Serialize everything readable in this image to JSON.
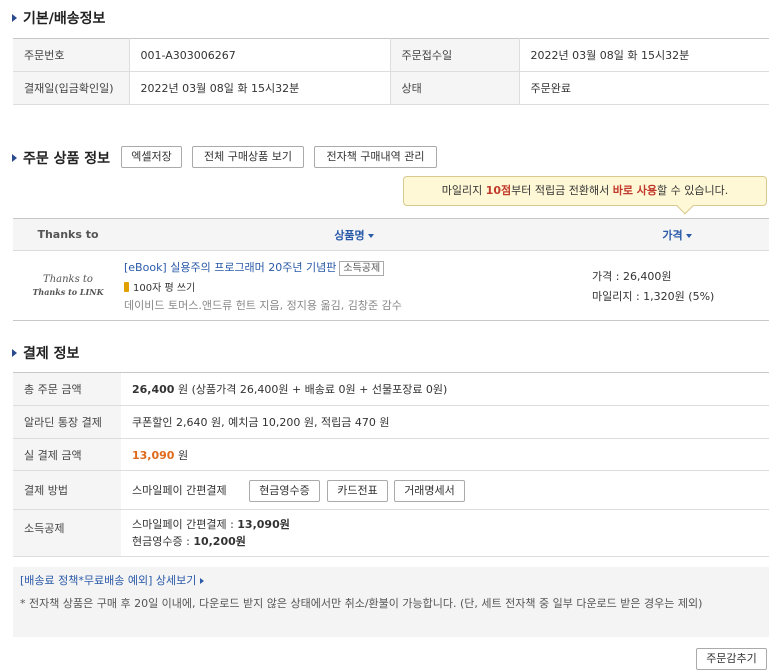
{
  "basic": {
    "title": "기본/배송정보",
    "rows": [
      {
        "l1": "주문번호",
        "v1": "001-A303006267",
        "l2": "주문접수일",
        "v2": "2022년 03월 08일 화 15시32분"
      },
      {
        "l1": "결재일(입금확인일)",
        "v1": "2022년 03월 08일 화 15시32분",
        "l2": "상태",
        "v2": "주문완료"
      }
    ]
  },
  "order_items": {
    "title": "주문 상품 정보",
    "buttons": {
      "excel": "엑셀저장",
      "all": "전체 구매상품 보기",
      "ebook": "전자책 구매내역 관리"
    },
    "tooltip": {
      "pre": "마일리지 ",
      "hl1": "10점",
      "mid": "부터 적립금 전환해서 ",
      "hl2": "바로 사용",
      "post": "할 수 있습니다."
    },
    "headers": {
      "thanks": "Thanks to",
      "product": "상품명",
      "price": "가격"
    },
    "logo": {
      "line1": "Thanks to",
      "line2": "Thanks to LINK"
    },
    "item": {
      "title": "[eBook] 실용주의 프로그래머 20주년 기념판",
      "tag": "소득공제",
      "review": "100자 평 쓰기",
      "authors": "데이비드 토머스.앤드류 헌트 지음, 정지용 옮김, 김창준 감수",
      "price": "가격 : 26,400원",
      "mileage": "마일리지 : 1,320원 (5%)"
    }
  },
  "payment": {
    "title": "결제 정보",
    "total_label": "총 주문 금액",
    "total_amount": "26,400",
    "total_detail": " 원 (상품가격 26,400원 + 배송료 0원 + 선물포장료 0원)",
    "aladin_label": "알라딘 통장 결제",
    "aladin_value": "쿠폰할인 2,640 원, 예치금 10,200 원, 적립금 470 원",
    "actual_label": "실 결제 금액",
    "actual_amount": "13,090",
    "actual_unit": " 원",
    "method_label": "결제 방법",
    "method_value": "스마일페이 간편결제",
    "method_buttons": {
      "cash": "현금영수증",
      "card": "카드전표",
      "stmt": "거래명세서"
    },
    "deduction_label": "소득공제",
    "deduction_line1_pre": "스마일페이 간편결제 : ",
    "deduction_line1_val": "13,090원",
    "deduction_line2_pre": "현금영수증 : ",
    "deduction_line2_val": "10,200원"
  },
  "notice": {
    "policy_link": "[배송료 정책*무료배송 예외] 상세보기",
    "text": "전자책 상품은 구매 후 20일 이내에, 다운로드 받지 않은 상태에서만 취소/환불이 가능합니다. (단, 세트 전자책 중 일부 다운로드 받은 경우는 제외)"
  },
  "footer": {
    "hide_button": "주문감추기"
  }
}
